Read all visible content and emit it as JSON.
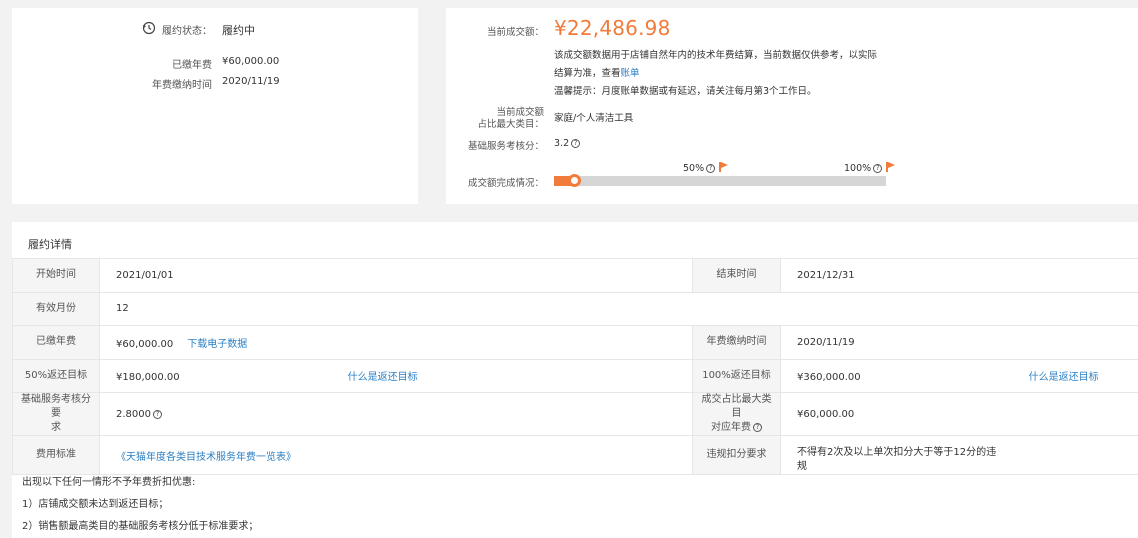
{
  "summary": {
    "status_label": "履约状态：",
    "status_value": "履约中",
    "paid_fee_label": "已缴年费",
    "paid_fee_value": "¥60,000.00",
    "fee_time_label": "年费缴纳时间",
    "fee_time_value": "2020/11/19"
  },
  "current": {
    "amount_label": "当前成交额：",
    "amount_value": "¥22,486.98",
    "desc_line1": "该成交额数据用于店铺自然年内的技术年费结算，当前数据仅供参考，以实际",
    "desc_line2_prefix": "结算为准，查看",
    "desc_line2_link": "账单",
    "tip": "温馨提示：月度账单数据或有延迟，请关注每月第3个工作日。",
    "category_label_line1": "当前成交额",
    "category_label_line2": "占比最大类目：",
    "category_value": "家庭/个人清洁工具",
    "score_label": "基础服务考核分：",
    "score_value": "3.2",
    "progress_label": "成交额完成情况：",
    "marker_50": "50%",
    "marker_100": "100%",
    "progress_fraction": 0.03
  },
  "detail": {
    "title": "履约详情",
    "start_time_label": "开始时间",
    "start_time_value": "2021/01/01",
    "end_time_label": "结束时间",
    "end_time_value": "2021/12/31",
    "months_label": "有效月份",
    "months_value": "12",
    "paid_fee_label": "已缴年费",
    "paid_fee_value": "¥60,000.00",
    "download_link": "下载电子数据",
    "fee_time_label": "年费缴纳时间",
    "fee_time_value": "2020/11/19",
    "target50_label": "50%返还目标",
    "target50_value": "¥180,000.00",
    "target50_link": "什么是返还目标",
    "target100_label": "100%返还目标",
    "target100_value": "¥360,000.00",
    "target100_link": "什么是返还目标",
    "score_req_label_line1": "基础服务考核分要",
    "score_req_label_line2": "求",
    "score_req_value": "2.8000",
    "cat_fee_label_line1": "成交占比最大类目",
    "cat_fee_label_line2": "对应年费",
    "cat_fee_value": "¥60,000.00",
    "fee_std_label": "费用标准",
    "fee_std_link": "《天猫年度各类目技术服务年费一览表》",
    "violation_label": "违规扣分要求",
    "violation_value_line1": "不得有2次及以上单次扣分大于等于12分的违",
    "violation_value_line2": "规"
  },
  "notes": {
    "intro": "出现以下任何一情形不予年费折扣优惠:",
    "item1": "1）店铺成交额未达到返还目标；",
    "item2": "2）销售额最高类目的基础服务考核分低于标准要求；"
  }
}
